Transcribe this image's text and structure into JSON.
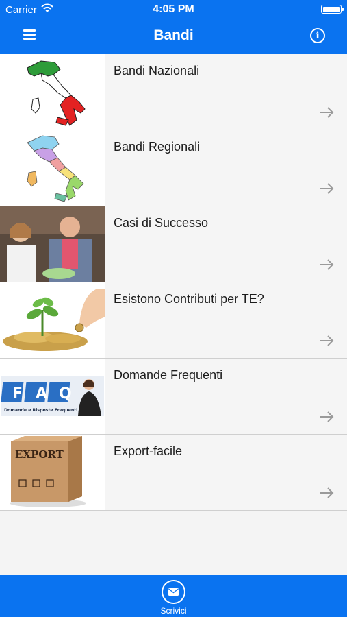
{
  "status_bar": {
    "carrier": "Carrier",
    "time": "4:05 PM"
  },
  "nav": {
    "title": "Bandi",
    "menu_icon": "hamburger-icon",
    "info_icon": "info-icon"
  },
  "items": [
    {
      "label": "Bandi Nazionali",
      "thumb": "italy-flag-map"
    },
    {
      "label": "Bandi Regionali",
      "thumb": "italy-regions-map"
    },
    {
      "label": "Casi di Successo",
      "thumb": "success-people-photo"
    },
    {
      "label": "Esistono Contributi per TE?",
      "thumb": "coins-plant-photo"
    },
    {
      "label": "Domande Frequenti",
      "thumb": "faq-banner",
      "thumb_text": [
        "F",
        "A",
        "Q"
      ],
      "thumb_caption": "Domande e Risposte Frequenti"
    },
    {
      "label": "Export-facile",
      "thumb": "export-box",
      "thumb_text": "EXPORT"
    }
  ],
  "tab_bar": {
    "compose_label": "Scrivici",
    "compose_icon": "envelope-icon"
  },
  "colors": {
    "accent": "#0a73f0",
    "row_bg": "#f5f5f5",
    "separator": "#cfcfcf"
  }
}
